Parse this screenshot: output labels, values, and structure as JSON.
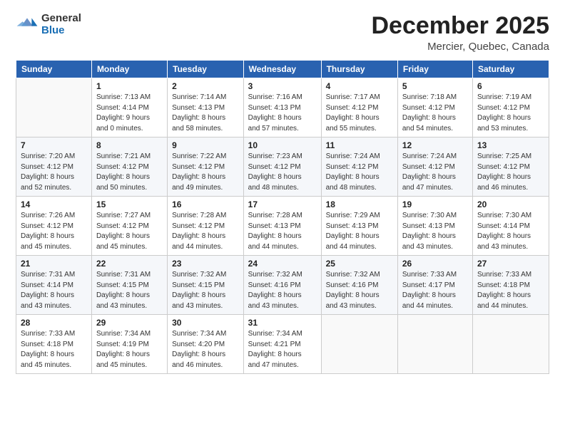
{
  "logo": {
    "general": "General",
    "blue": "Blue"
  },
  "title": "December 2025",
  "subtitle": "Mercier, Quebec, Canada",
  "days_of_week": [
    "Sunday",
    "Monday",
    "Tuesday",
    "Wednesday",
    "Thursday",
    "Friday",
    "Saturday"
  ],
  "weeks": [
    [
      {
        "num": "",
        "info": ""
      },
      {
        "num": "1",
        "info": "Sunrise: 7:13 AM\nSunset: 4:14 PM\nDaylight: 9 hours\nand 0 minutes."
      },
      {
        "num": "2",
        "info": "Sunrise: 7:14 AM\nSunset: 4:13 PM\nDaylight: 8 hours\nand 58 minutes."
      },
      {
        "num": "3",
        "info": "Sunrise: 7:16 AM\nSunset: 4:13 PM\nDaylight: 8 hours\nand 57 minutes."
      },
      {
        "num": "4",
        "info": "Sunrise: 7:17 AM\nSunset: 4:12 PM\nDaylight: 8 hours\nand 55 minutes."
      },
      {
        "num": "5",
        "info": "Sunrise: 7:18 AM\nSunset: 4:12 PM\nDaylight: 8 hours\nand 54 minutes."
      },
      {
        "num": "6",
        "info": "Sunrise: 7:19 AM\nSunset: 4:12 PM\nDaylight: 8 hours\nand 53 minutes."
      }
    ],
    [
      {
        "num": "7",
        "info": "Sunrise: 7:20 AM\nSunset: 4:12 PM\nDaylight: 8 hours\nand 52 minutes."
      },
      {
        "num": "8",
        "info": "Sunrise: 7:21 AM\nSunset: 4:12 PM\nDaylight: 8 hours\nand 50 minutes."
      },
      {
        "num": "9",
        "info": "Sunrise: 7:22 AM\nSunset: 4:12 PM\nDaylight: 8 hours\nand 49 minutes."
      },
      {
        "num": "10",
        "info": "Sunrise: 7:23 AM\nSunset: 4:12 PM\nDaylight: 8 hours\nand 48 minutes."
      },
      {
        "num": "11",
        "info": "Sunrise: 7:24 AM\nSunset: 4:12 PM\nDaylight: 8 hours\nand 48 minutes."
      },
      {
        "num": "12",
        "info": "Sunrise: 7:24 AM\nSunset: 4:12 PM\nDaylight: 8 hours\nand 47 minutes."
      },
      {
        "num": "13",
        "info": "Sunrise: 7:25 AM\nSunset: 4:12 PM\nDaylight: 8 hours\nand 46 minutes."
      }
    ],
    [
      {
        "num": "14",
        "info": "Sunrise: 7:26 AM\nSunset: 4:12 PM\nDaylight: 8 hours\nand 45 minutes."
      },
      {
        "num": "15",
        "info": "Sunrise: 7:27 AM\nSunset: 4:12 PM\nDaylight: 8 hours\nand 45 minutes."
      },
      {
        "num": "16",
        "info": "Sunrise: 7:28 AM\nSunset: 4:12 PM\nDaylight: 8 hours\nand 44 minutes."
      },
      {
        "num": "17",
        "info": "Sunrise: 7:28 AM\nSunset: 4:13 PM\nDaylight: 8 hours\nand 44 minutes."
      },
      {
        "num": "18",
        "info": "Sunrise: 7:29 AM\nSunset: 4:13 PM\nDaylight: 8 hours\nand 44 minutes."
      },
      {
        "num": "19",
        "info": "Sunrise: 7:30 AM\nSunset: 4:13 PM\nDaylight: 8 hours\nand 43 minutes."
      },
      {
        "num": "20",
        "info": "Sunrise: 7:30 AM\nSunset: 4:14 PM\nDaylight: 8 hours\nand 43 minutes."
      }
    ],
    [
      {
        "num": "21",
        "info": "Sunrise: 7:31 AM\nSunset: 4:14 PM\nDaylight: 8 hours\nand 43 minutes."
      },
      {
        "num": "22",
        "info": "Sunrise: 7:31 AM\nSunset: 4:15 PM\nDaylight: 8 hours\nand 43 minutes."
      },
      {
        "num": "23",
        "info": "Sunrise: 7:32 AM\nSunset: 4:15 PM\nDaylight: 8 hours\nand 43 minutes."
      },
      {
        "num": "24",
        "info": "Sunrise: 7:32 AM\nSunset: 4:16 PM\nDaylight: 8 hours\nand 43 minutes."
      },
      {
        "num": "25",
        "info": "Sunrise: 7:32 AM\nSunset: 4:16 PM\nDaylight: 8 hours\nand 43 minutes."
      },
      {
        "num": "26",
        "info": "Sunrise: 7:33 AM\nSunset: 4:17 PM\nDaylight: 8 hours\nand 44 minutes."
      },
      {
        "num": "27",
        "info": "Sunrise: 7:33 AM\nSunset: 4:18 PM\nDaylight: 8 hours\nand 44 minutes."
      }
    ],
    [
      {
        "num": "28",
        "info": "Sunrise: 7:33 AM\nSunset: 4:18 PM\nDaylight: 8 hours\nand 45 minutes."
      },
      {
        "num": "29",
        "info": "Sunrise: 7:34 AM\nSunset: 4:19 PM\nDaylight: 8 hours\nand 45 minutes."
      },
      {
        "num": "30",
        "info": "Sunrise: 7:34 AM\nSunset: 4:20 PM\nDaylight: 8 hours\nand 46 minutes."
      },
      {
        "num": "31",
        "info": "Sunrise: 7:34 AM\nSunset: 4:21 PM\nDaylight: 8 hours\nand 47 minutes."
      },
      {
        "num": "",
        "info": ""
      },
      {
        "num": "",
        "info": ""
      },
      {
        "num": "",
        "info": ""
      }
    ]
  ]
}
